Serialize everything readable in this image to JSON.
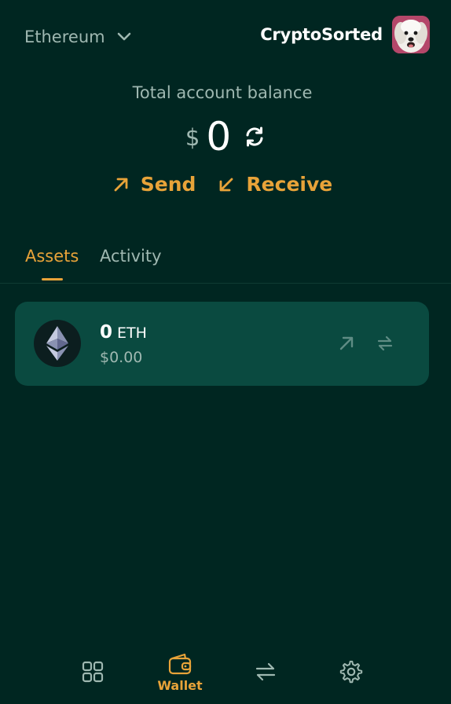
{
  "header": {
    "network": "Ethereum",
    "account_name": "CryptoSorted"
  },
  "balance": {
    "label": "Total account balance",
    "currency_symbol": "$",
    "amount": "0"
  },
  "actions": {
    "send": "Send",
    "receive": "Receive"
  },
  "tabs": [
    {
      "label": "Assets",
      "active": true
    },
    {
      "label": "Activity",
      "active": false
    }
  ],
  "assets": [
    {
      "quantity": "0",
      "symbol": "ETH",
      "fiat_value": "$0.00",
      "icon": "ethereum-icon"
    }
  ],
  "bottom_nav": {
    "items": [
      {
        "icon": "grid-icon",
        "label": ""
      },
      {
        "icon": "wallet-icon",
        "label": "Wallet",
        "active": true
      },
      {
        "icon": "swap-arrows-icon",
        "label": ""
      },
      {
        "icon": "gear-icon",
        "label": ""
      }
    ]
  },
  "colors": {
    "background": "#002621",
    "card": "#0a4a40",
    "accent": "#e8a339",
    "muted_text": "#9fb8b1",
    "text": "#ffffff"
  }
}
